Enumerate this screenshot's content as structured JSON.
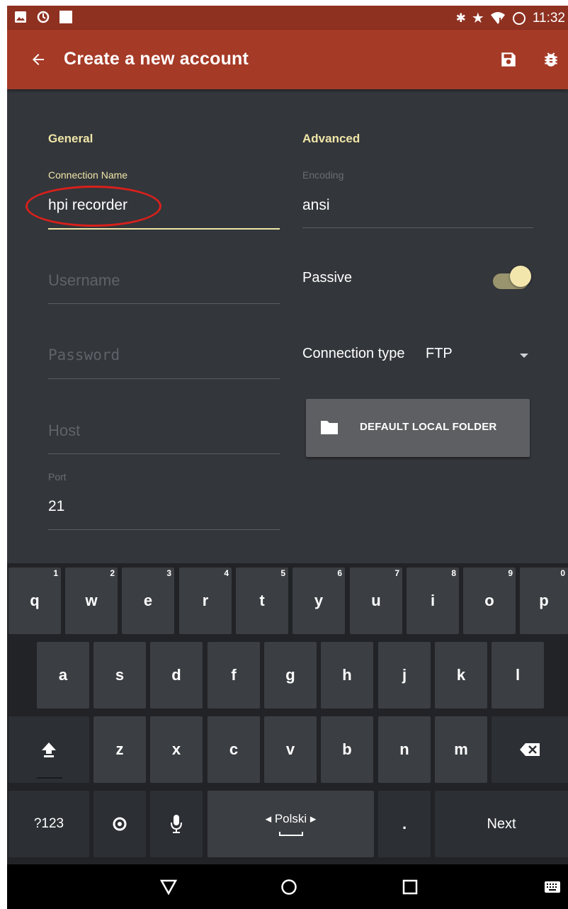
{
  "status_bar": {
    "left_icons": [
      "image-icon",
      "sync-icon",
      "square-icon"
    ],
    "right_icons": [
      "bluetooth-icon",
      "star-icon",
      "wifi-icon",
      "circle-icon"
    ],
    "time": "11:32"
  },
  "app_bar": {
    "title": "Create a new account",
    "back_icon": "arrow-left-icon",
    "actions": [
      "save-icon",
      "bug-icon"
    ]
  },
  "general": {
    "title": "General",
    "connection_name": {
      "label": "Connection Name",
      "value": "hpi recorder"
    },
    "username": {
      "placeholder": "Username"
    },
    "password": {
      "placeholder": "Password"
    },
    "host": {
      "placeholder": "Host"
    },
    "port": {
      "label": "Port",
      "value": "21"
    }
  },
  "advanced": {
    "title": "Advanced",
    "encoding": {
      "label": "Encoding",
      "value": "ansi"
    },
    "passive": {
      "label": "Passive",
      "enabled": true
    },
    "connection_type": {
      "label": "Connection type",
      "value": "FTP"
    },
    "default_folder_button": "DEFAULT LOCAL FOLDER"
  },
  "keyboard": {
    "row1": [
      {
        "key": "q",
        "hint": "1"
      },
      {
        "key": "w",
        "hint": "2"
      },
      {
        "key": "e",
        "hint": "3"
      },
      {
        "key": "r",
        "hint": "4"
      },
      {
        "key": "t",
        "hint": "5"
      },
      {
        "key": "y",
        "hint": "6"
      },
      {
        "key": "u",
        "hint": "7"
      },
      {
        "key": "i",
        "hint": "8"
      },
      {
        "key": "o",
        "hint": "9"
      },
      {
        "key": "p",
        "hint": "0"
      }
    ],
    "row2": [
      "a",
      "s",
      "d",
      "f",
      "g",
      "h",
      "j",
      "k",
      "l"
    ],
    "row3": [
      "z",
      "x",
      "c",
      "v",
      "b",
      "n",
      "m"
    ],
    "symbols_key": "?123",
    "space_label": "◂ Polski ▸",
    "period_key": ".",
    "next_key": "Next"
  },
  "colors": {
    "status_bar": "#8e3121",
    "app_bar": "#a53a27",
    "background": "#33363b",
    "accent": "#f0e6a8",
    "annotation": "#d9201b"
  }
}
